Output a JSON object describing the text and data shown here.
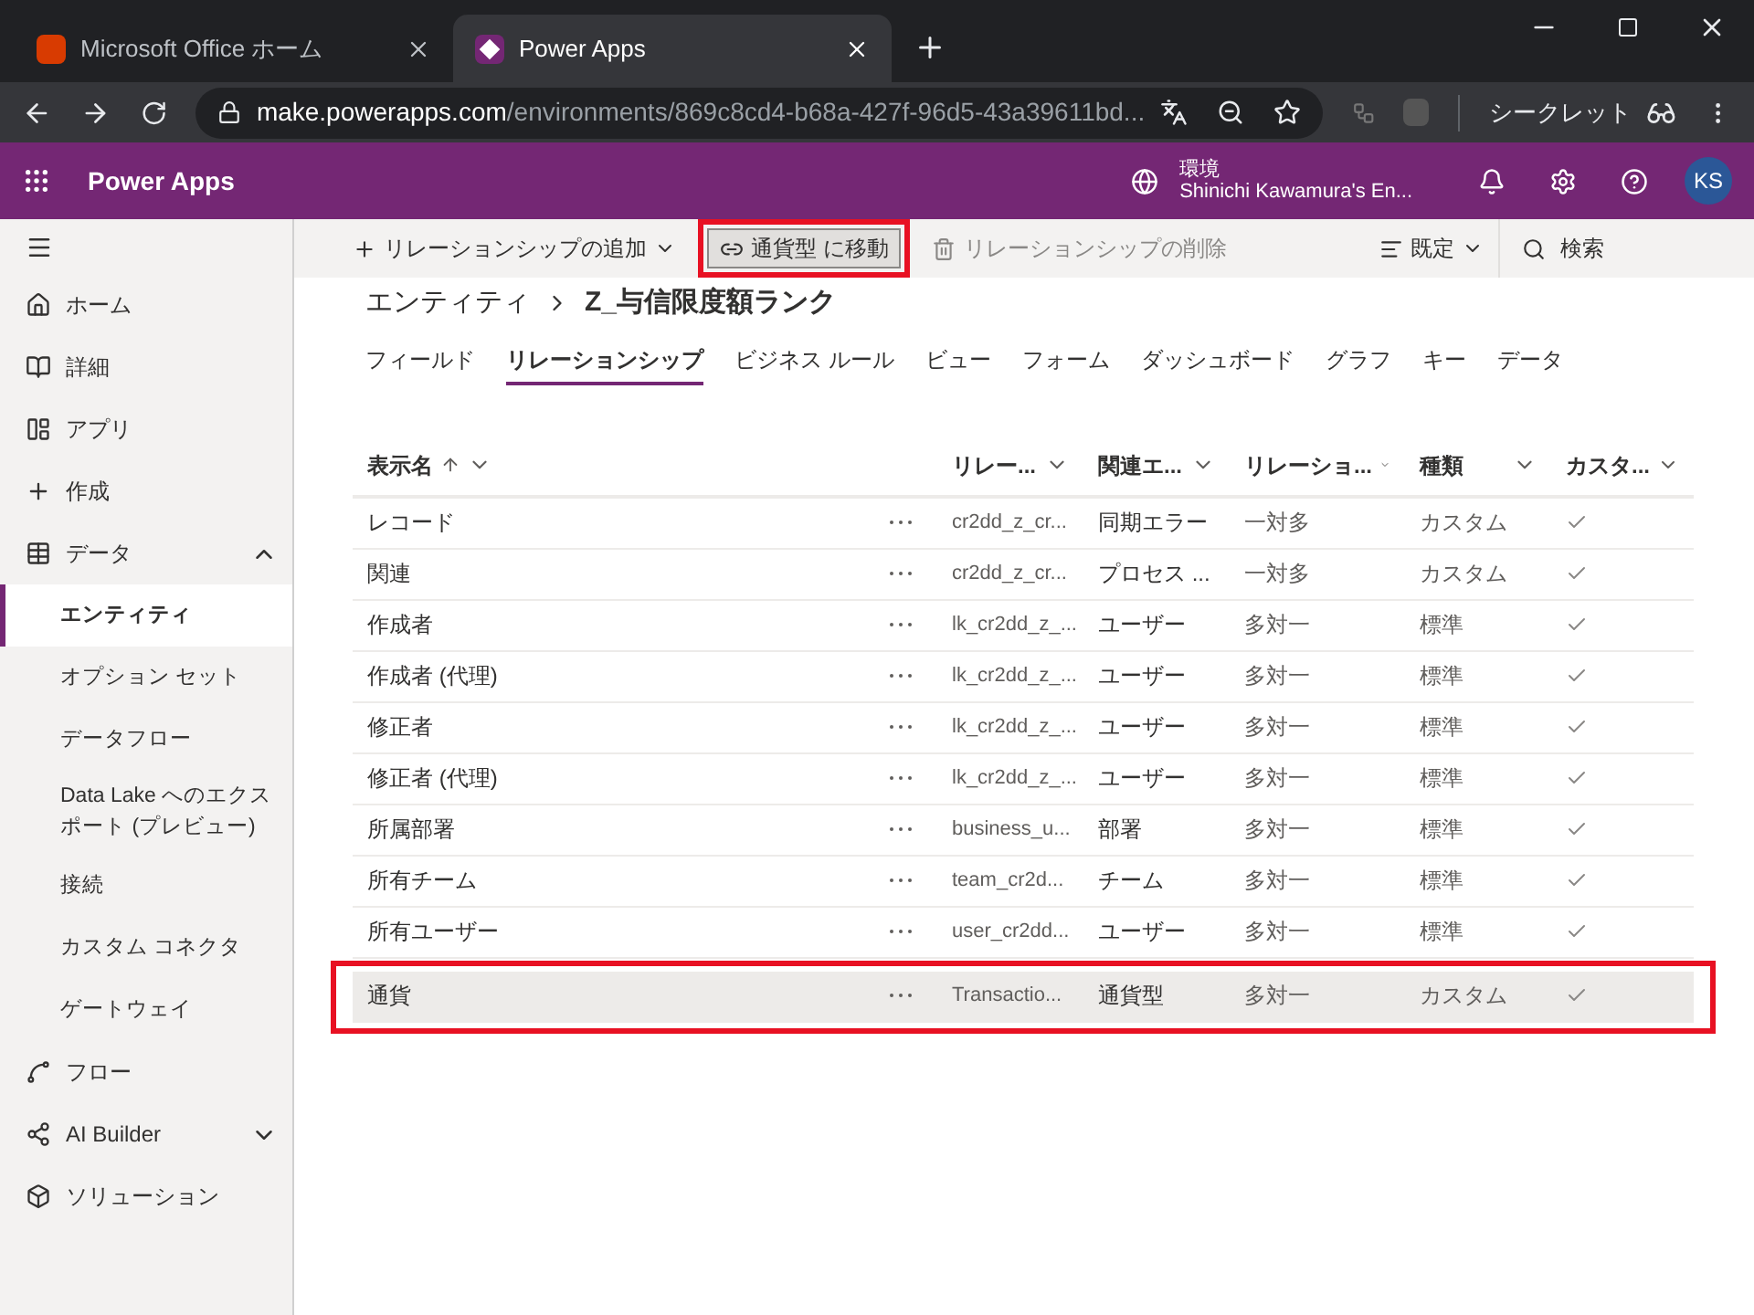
{
  "browser": {
    "tabs": [
      {
        "title": "Microsoft Office ホーム",
        "selected": false,
        "kind": "office"
      },
      {
        "title": "Power Apps",
        "selected": true,
        "kind": "powerapps"
      }
    ],
    "url_host": "make.powerapps.com",
    "url_path": "/environments/869c8cd4-b68a-427f-96d5-43a39611bd...",
    "incognito_label": "シークレット"
  },
  "app": {
    "name": "Power Apps",
    "env_label": "環境",
    "env_name": "Shinichi Kawamura's En...",
    "avatar": "KS"
  },
  "toolbar": {
    "items": [
      {
        "label": "リレーションシップの追加",
        "kind": "add",
        "disabled": false,
        "highlighted": false
      },
      {
        "label": "通貨型 に移動",
        "kind": "move",
        "disabled": false,
        "highlighted": true
      },
      {
        "label": "リレーションシップの削除",
        "kind": "delete",
        "disabled": true,
        "highlighted": false
      }
    ],
    "view_label": "既定",
    "search_placeholder": "検索"
  },
  "sidebar": {
    "items": [
      {
        "label": "ホーム",
        "kind": "home",
        "selected": false
      },
      {
        "label": "詳細",
        "kind": "learn",
        "selected": false
      },
      {
        "label": "アプリ",
        "kind": "apps",
        "selected": false
      },
      {
        "label": "作成",
        "kind": "create",
        "selected": false
      },
      {
        "label": "データ",
        "kind": "data",
        "selected": false,
        "expanded": true,
        "children": [
          {
            "label": "エンティティ",
            "selected": true
          },
          {
            "label": "オプション セット",
            "selected": false
          },
          {
            "label": "データフロー",
            "selected": false
          },
          {
            "label": "Data Lake へのエクスポート (プレビュー)",
            "selected": false
          },
          {
            "label": "接続",
            "selected": false
          },
          {
            "label": "カスタム コネクタ",
            "selected": false
          },
          {
            "label": "ゲートウェイ",
            "selected": false
          }
        ]
      },
      {
        "label": "フロー",
        "kind": "flow",
        "selected": false
      },
      {
        "label": "AI Builder",
        "kind": "ai",
        "selected": false,
        "expanded": false
      },
      {
        "label": "ソリューション",
        "kind": "solutions",
        "selected": false
      }
    ]
  },
  "breadcrumb": [
    "エンティティ",
    "Z_与信限度額ランク"
  ],
  "tabs": [
    {
      "label": "フィールド",
      "selected": false
    },
    {
      "label": "リレーションシップ",
      "selected": true
    },
    {
      "label": "ビジネス ルール",
      "selected": false
    },
    {
      "label": "ビュー",
      "selected": false
    },
    {
      "label": "フォーム",
      "selected": false
    },
    {
      "label": "ダッシュボード",
      "selected": false
    },
    {
      "label": "グラフ",
      "selected": false
    },
    {
      "label": "キー",
      "selected": false
    },
    {
      "label": "データ",
      "selected": false
    }
  ],
  "table": {
    "columns": [
      {
        "label": "表示名",
        "sorted": true
      },
      {
        "label": "リレー...",
        "sorted": false
      },
      {
        "label": "関連エ...",
        "sorted": false
      },
      {
        "label": "リレーショ...",
        "sorted": false
      },
      {
        "label": "種類",
        "sorted": false
      },
      {
        "label": "カスタ...",
        "sorted": false
      }
    ],
    "rows": [
      {
        "name": "レコード",
        "schema": "cr2dd_z_cr...",
        "related": "同期エラー",
        "relation": "一対多",
        "type": "カスタム",
        "custom": true,
        "highlighted": false
      },
      {
        "name": "関連",
        "schema": "cr2dd_z_cr...",
        "related": "プロセス ...",
        "relation": "一対多",
        "type": "カスタム",
        "custom": true,
        "highlighted": false
      },
      {
        "name": "作成者",
        "schema": "lk_cr2dd_z_...",
        "related": "ユーザー",
        "relation": "多対一",
        "type": "標準",
        "custom": true,
        "highlighted": false
      },
      {
        "name": "作成者 (代理)",
        "schema": "lk_cr2dd_z_...",
        "related": "ユーザー",
        "relation": "多対一",
        "type": "標準",
        "custom": true,
        "highlighted": false
      },
      {
        "name": "修正者",
        "schema": "lk_cr2dd_z_...",
        "related": "ユーザー",
        "relation": "多対一",
        "type": "標準",
        "custom": true,
        "highlighted": false
      },
      {
        "name": "修正者 (代理)",
        "schema": "lk_cr2dd_z_...",
        "related": "ユーザー",
        "relation": "多対一",
        "type": "標準",
        "custom": true,
        "highlighted": false
      },
      {
        "name": "所属部署",
        "schema": "business_u...",
        "related": "部署",
        "relation": "多対一",
        "type": "標準",
        "custom": true,
        "highlighted": false
      },
      {
        "name": "所有チーム",
        "schema": "team_cr2d...",
        "related": "チーム",
        "relation": "多対一",
        "type": "標準",
        "custom": true,
        "highlighted": false
      },
      {
        "name": "所有ユーザー",
        "schema": "user_cr2dd...",
        "related": "ユーザー",
        "relation": "多対一",
        "type": "標準",
        "custom": true,
        "highlighted": false
      },
      {
        "name": "通貨",
        "schema": "Transactio...",
        "related": "通貨型",
        "relation": "多対一",
        "type": "カスタム",
        "custom": true,
        "highlighted": true
      }
    ]
  }
}
